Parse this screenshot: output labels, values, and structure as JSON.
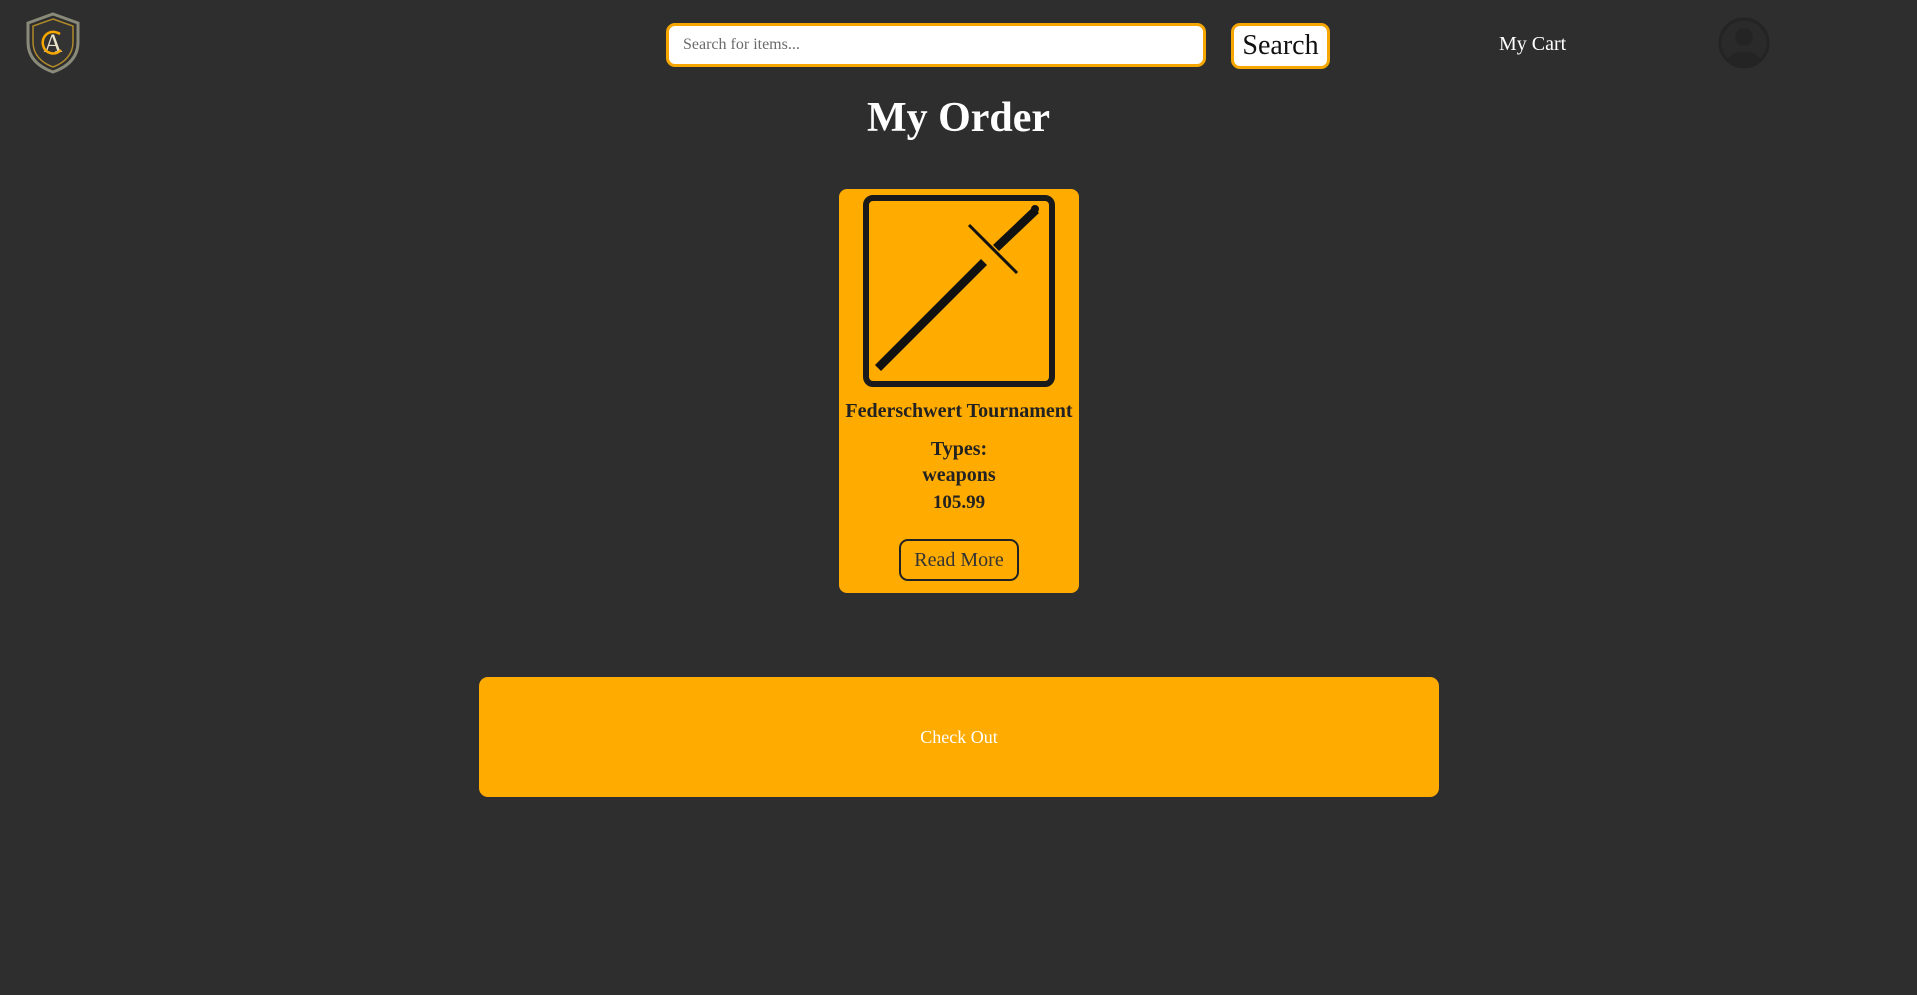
{
  "header": {
    "logo_letters": "CA",
    "search": {
      "placeholder": "Search for items...",
      "value": "",
      "button_label": "Search"
    },
    "cart_label": "My Cart",
    "avatar_icon": "user-circle-icon"
  },
  "page": {
    "title": "My Order"
  },
  "order": {
    "items": [
      {
        "name": "Federschwert Tournament",
        "types_label": "Types:",
        "types": "weapons",
        "price": "105.99",
        "read_more_label": "Read More",
        "image_icon": "sword-icon"
      }
    ],
    "checkout_label": "Check Out"
  },
  "colors": {
    "background": "#2e2e2e",
    "accent": "#ffab00",
    "border_accent": "#f5a700",
    "text_light": "#ffffff",
    "text_dark": "#222222"
  }
}
